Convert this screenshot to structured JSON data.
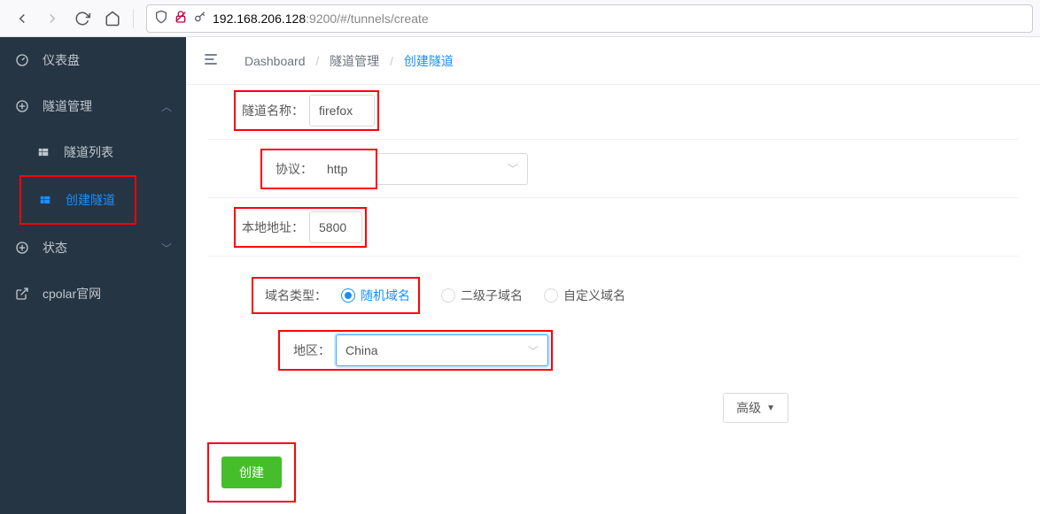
{
  "browser": {
    "url_host": "192.168.206.128",
    "url_path": ":9200/#/tunnels/create"
  },
  "sidebar": {
    "dashboard": "仪表盘",
    "tunnel_mgmt": "隧道管理",
    "tunnel_list": "隧道列表",
    "tunnel_create": "创建隧道",
    "status": "状态",
    "cpolar_site": "cpolar官网"
  },
  "breadcrumb": {
    "dashboard": "Dashboard",
    "tunnel_mgmt": "隧道管理",
    "tunnel_create": "创建隧道"
  },
  "form": {
    "name_label": "隧道名称：",
    "name_value": "firefox",
    "protocol_label": "协议：",
    "protocol_value": "http",
    "local_addr_label": "本地地址：",
    "local_addr_value": "5800",
    "domain_type_label": "域名类型：",
    "domain_opts": {
      "random": "随机域名",
      "subdomain": "二级子域名",
      "custom": "自定义域名"
    },
    "region_label": "地区：",
    "region_value": "China",
    "advanced_btn": "高级",
    "submit_btn": "创建"
  }
}
